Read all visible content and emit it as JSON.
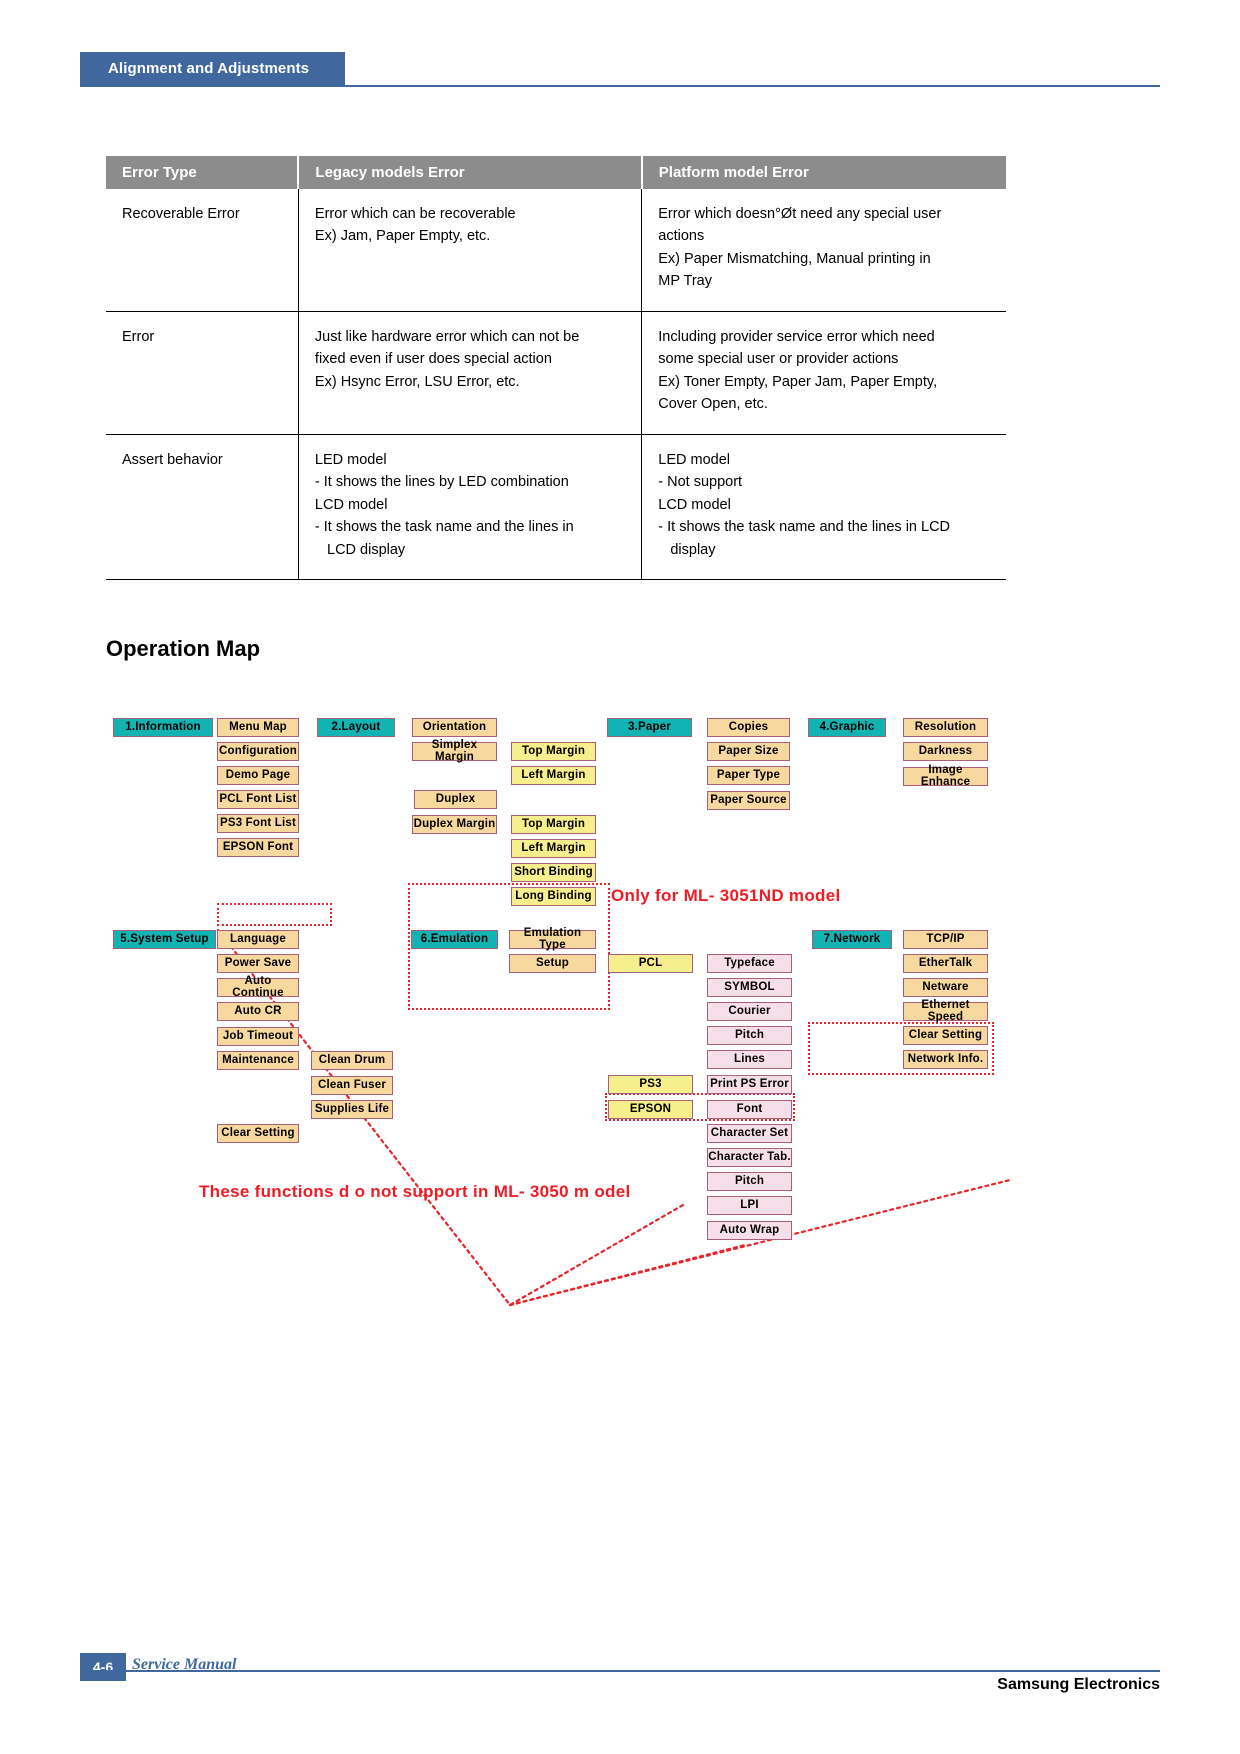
{
  "header": {
    "tab_label": "Alignment and Adjustments"
  },
  "table": {
    "columns": [
      "Error Type",
      "Legacy models Error",
      "Platform model Error"
    ],
    "rows": [
      {
        "type": "Recoverable Error",
        "legacy": [
          "Error which can be recoverable",
          "Ex) Jam, Paper Empty, etc."
        ],
        "platform": [
          "Error which doesn°Øt need any special user",
          "actions",
          "Ex) Paper Mismatching, Manual printing in",
          "MP Tray"
        ]
      },
      {
        "type": "Error",
        "legacy": [
          "Just like hardware error which can not be",
          "fixed even if user does special action",
          "Ex) Hsync Error, LSU Error, etc."
        ],
        "platform": [
          "Including provider service error which need",
          "some special user or provider actions",
          "Ex) Toner Empty, Paper Jam, Paper Empty,",
          "Cover Open, etc."
        ]
      },
      {
        "type": "Assert behavior",
        "legacy": [
          "LED model",
          "- It shows the lines by LED combination",
          "LCD model",
          "- It shows the task name and the lines in",
          "   LCD display"
        ],
        "platform": [
          "LED model",
          "- Not support",
          "LCD model",
          "- It shows the task name and the lines in LCD",
          "   display"
        ]
      }
    ]
  },
  "section": {
    "title": "Operation Map"
  },
  "diagram": {
    "notes": [
      {
        "id": "note_3051",
        "text": "Only for ML- 3051ND model"
      },
      {
        "id": "note_3050",
        "text": "These functions d o not support in ML- 3050 m odel"
      }
    ],
    "nodes": [
      {
        "id": "n_information",
        "label": "1.Information",
        "level": "root"
      },
      {
        "id": "n_menu_map",
        "label": "Menu Map",
        "level": "one"
      },
      {
        "id": "n_configuration",
        "label": "Configuration",
        "level": "one"
      },
      {
        "id": "n_demo_page",
        "label": "Demo Page",
        "level": "one"
      },
      {
        "id": "n_pcl_font_list",
        "label": "PCL Font List",
        "level": "one"
      },
      {
        "id": "n_ps3_font_list",
        "label": "PS3 Font List",
        "level": "one"
      },
      {
        "id": "n_epson_font",
        "label": "EPSON Font",
        "level": "one"
      },
      {
        "id": "n_layout",
        "label": "2.Layout",
        "level": "root"
      },
      {
        "id": "n_orientation",
        "label": "Orientation",
        "level": "one"
      },
      {
        "id": "n_simplex_margin",
        "label": "Simplex Margin",
        "level": "one"
      },
      {
        "id": "n_top_margin_1",
        "label": "Top Margin",
        "level": "two"
      },
      {
        "id": "n_left_margin_1",
        "label": "Left Margin",
        "level": "two"
      },
      {
        "id": "n_duplex",
        "label": "Duplex",
        "level": "one"
      },
      {
        "id": "n_duplex_margin",
        "label": "Duplex Margin",
        "level": "one"
      },
      {
        "id": "n_top_margin_2",
        "label": "Top Margin",
        "level": "two"
      },
      {
        "id": "n_left_margin_2",
        "label": "Left Margin",
        "level": "two"
      },
      {
        "id": "n_short_binding",
        "label": "Short Binding",
        "level": "two"
      },
      {
        "id": "n_long_binding",
        "label": "Long Binding",
        "level": "two"
      },
      {
        "id": "n_paper",
        "label": "3.Paper",
        "level": "root"
      },
      {
        "id": "n_copies",
        "label": "Copies",
        "level": "one"
      },
      {
        "id": "n_paper_size",
        "label": "Paper Size",
        "level": "one"
      },
      {
        "id": "n_paper_type",
        "label": "Paper Type",
        "level": "one"
      },
      {
        "id": "n_paper_source",
        "label": "Paper Source",
        "level": "one"
      },
      {
        "id": "n_graphic",
        "label": "4.Graphic",
        "level": "root"
      },
      {
        "id": "n_resolution",
        "label": "Resolution",
        "level": "one"
      },
      {
        "id": "n_darkness",
        "label": "Darkness",
        "level": "one"
      },
      {
        "id": "n_image_enhance",
        "label": "Image Enhance",
        "level": "one"
      },
      {
        "id": "n_system_setup",
        "label": "5.System Setup",
        "level": "root"
      },
      {
        "id": "n_language",
        "label": "Language",
        "level": "one"
      },
      {
        "id": "n_power_save",
        "label": "Power Save",
        "level": "one"
      },
      {
        "id": "n_auto_continue",
        "label": "Auto Continue",
        "level": "one"
      },
      {
        "id": "n_auto_cr",
        "label": "Auto CR",
        "level": "one"
      },
      {
        "id": "n_job_timeout",
        "label": "Job Timeout",
        "level": "one"
      },
      {
        "id": "n_maintenance",
        "label": "Maintenance",
        "level": "one"
      },
      {
        "id": "n_clean_drum",
        "label": "Clean Drum",
        "level": "one"
      },
      {
        "id": "n_clean_fuser",
        "label": "Clean Fuser",
        "level": "one"
      },
      {
        "id": "n_supplies_life",
        "label": "Supplies Life",
        "level": "one"
      },
      {
        "id": "n_clear_setting_1",
        "label": "Clear Setting",
        "level": "one"
      },
      {
        "id": "n_emulation",
        "label": "6.Emulation",
        "level": "root"
      },
      {
        "id": "n_emulation_type",
        "label": "Emulation Type",
        "level": "one"
      },
      {
        "id": "n_setup",
        "label": "Setup",
        "level": "one"
      },
      {
        "id": "n_pcl",
        "label": "PCL",
        "level": "two"
      },
      {
        "id": "n_typeface",
        "label": "Typeface",
        "level": "three"
      },
      {
        "id": "n_symbol",
        "label": "SYMBOL",
        "level": "three"
      },
      {
        "id": "n_courier",
        "label": "Courier",
        "level": "three"
      },
      {
        "id": "n_pitch_1",
        "label": "Pitch",
        "level": "three"
      },
      {
        "id": "n_lines",
        "label": "Lines",
        "level": "three"
      },
      {
        "id": "n_ps3",
        "label": "PS3",
        "level": "two"
      },
      {
        "id": "n_print_ps_error",
        "label": "Print PS Error",
        "level": "three"
      },
      {
        "id": "n_epson",
        "label": "EPSON",
        "level": "two"
      },
      {
        "id": "n_font",
        "label": "Font",
        "level": "three"
      },
      {
        "id": "n_character_set",
        "label": "Character Set",
        "level": "three"
      },
      {
        "id": "n_character_tab",
        "label": "Character Tab.",
        "level": "three"
      },
      {
        "id": "n_pitch_2",
        "label": "Pitch",
        "level": "three"
      },
      {
        "id": "n_lpi",
        "label": "LPI",
        "level": "three"
      },
      {
        "id": "n_auto_wrap",
        "label": "Auto Wrap",
        "level": "three"
      },
      {
        "id": "n_network",
        "label": "7.Network",
        "level": "root"
      },
      {
        "id": "n_tcpip",
        "label": "TCP/IP",
        "level": "one"
      },
      {
        "id": "n_ethertalk",
        "label": "EtherTalk",
        "level": "one"
      },
      {
        "id": "n_netware",
        "label": "Netware",
        "level": "one"
      },
      {
        "id": "n_ethernet_speed",
        "label": "Ethernet Speed",
        "level": "one"
      },
      {
        "id": "n_clear_setting_2",
        "label": "Clear Setting",
        "level": "one"
      },
      {
        "id": "n_network_info",
        "label": "Network Info.",
        "level": "one"
      }
    ]
  },
  "footer": {
    "page_number": "4-6",
    "manual_label": "Service Manual",
    "brand": "Samsung Electronics"
  },
  "colors": {
    "accent_blue": "#41689e",
    "header_gray": "#8c8c8c",
    "node_root": "#12b3b3",
    "node_one": "#f7d9a0",
    "node_two": "#f7ef8d",
    "node_three": "#f7dfe9",
    "node_border": "#a85f7c",
    "annotation_red": "#ee1c24"
  }
}
